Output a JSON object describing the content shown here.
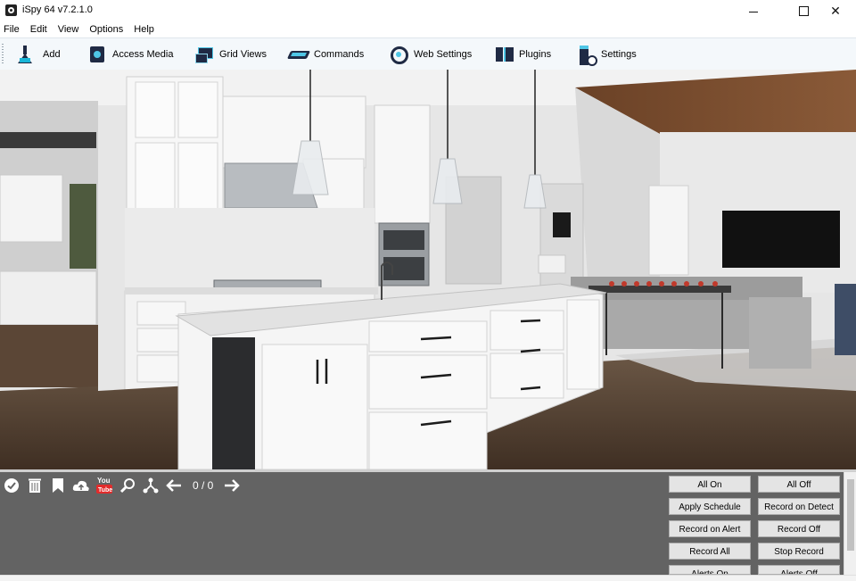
{
  "window": {
    "title": "iSpy 64 v7.2.1.0",
    "minimize_symbol": "",
    "close_symbol": "✕"
  },
  "menu": {
    "items": [
      "File",
      "Edit",
      "View",
      "Options",
      "Help"
    ]
  },
  "toolbar": {
    "buttons": [
      {
        "label": "Add",
        "icon": "add-flask-icon"
      },
      {
        "label": "Access Media",
        "icon": "access-media-icon"
      },
      {
        "label": "Grid Views",
        "icon": "grid-views-icon"
      },
      {
        "label": "Commands",
        "icon": "commands-icon"
      },
      {
        "label": "Web Settings",
        "icon": "web-settings-icon"
      },
      {
        "label": "Plugins",
        "icon": "plugins-icon"
      },
      {
        "label": "Settings",
        "icon": "settings-icon"
      }
    ]
  },
  "camera": {
    "content": "kitchen-living-room-camera-feed"
  },
  "lower_toolbar": {
    "icons": [
      "check-icon",
      "trash-icon",
      "bookmark-icon",
      "cloud-upload-icon",
      "youtube-icon",
      "search-icon",
      "share-icon",
      "arrow-left-icon",
      "arrow-right-icon"
    ],
    "counter": "0 / 0",
    "youtube_label": "You Tube"
  },
  "control_buttons": {
    "all_on": "All On",
    "all_off": "All Off",
    "apply_schedule": "Apply Schedule",
    "record_on_detect": "Record on Detect",
    "record_on_alert": "Record on Alert",
    "record_off": "Record Off",
    "record_all": "Record All",
    "stop_record": "Stop Record",
    "alerts_on": "Alerts On",
    "alerts_off": "Alerts Off"
  },
  "colors": {
    "panel_bg": "#636363",
    "toolbar_bg": "#f4f8fb",
    "icon_dark": "#1f2a44",
    "icon_accent": "#4fc6e6"
  }
}
